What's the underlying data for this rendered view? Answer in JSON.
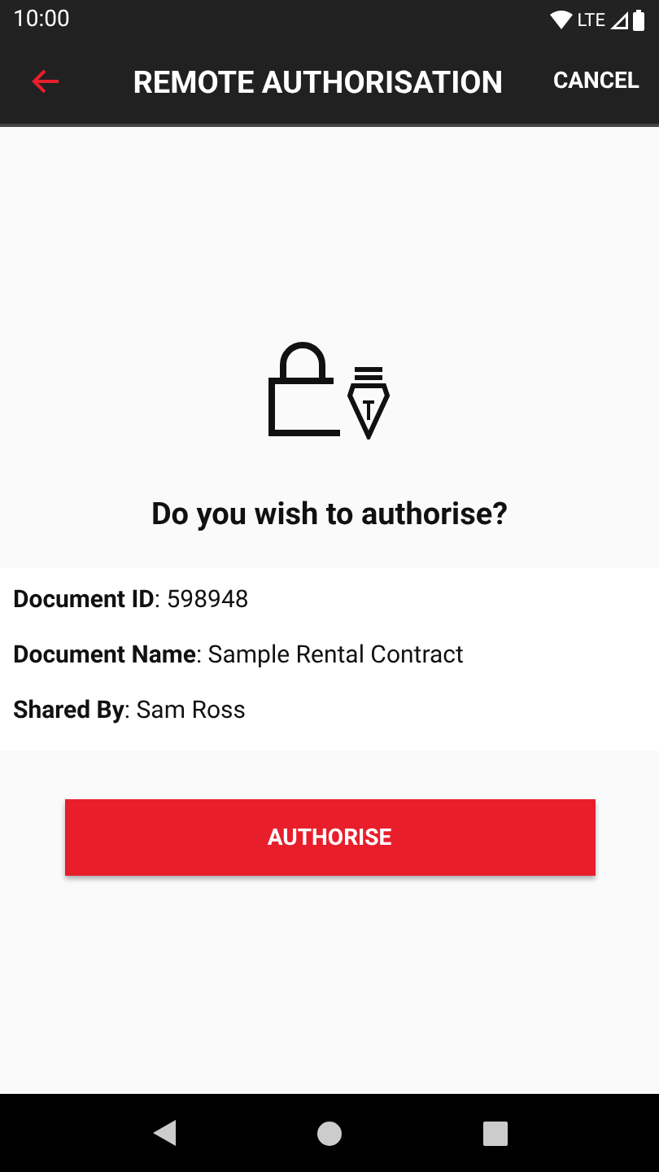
{
  "status_bar": {
    "time": "10:00",
    "network": "LTE"
  },
  "app_bar": {
    "title": "REMOTE AUTHORISATION",
    "action": "CANCEL"
  },
  "prompt": "Do you wish to authorise?",
  "details": [
    "**Document ID**: 598948",
    "**Document Name**: Sample Rental Contract",
    "**Shared By**: Sam Ross"
  ],
  "button": "AUTHORISE"
}
